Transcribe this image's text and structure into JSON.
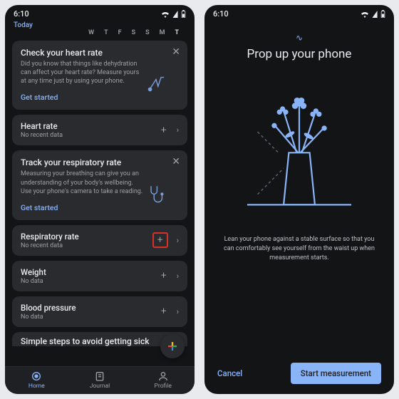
{
  "status": {
    "time": "6:10"
  },
  "left": {
    "today_label": "Today",
    "weekdays": [
      "W",
      "T",
      "F",
      "S",
      "S",
      "M",
      "T"
    ],
    "promo_heart": {
      "title": "Check your heart rate",
      "desc": "Did you know that things like dehydration can affect your heart rate? Measure yours at any time just by using your phone.",
      "cta": "Get started"
    },
    "row_heart": {
      "title": "Heart rate",
      "sub": "No recent data"
    },
    "promo_resp": {
      "title": "Track your respiratory rate",
      "desc": "Measuring your breathing can give you an understanding of your body's wellbeing. Use your phone's camera to take a reading.",
      "cta": "Get started"
    },
    "row_resp": {
      "title": "Respiratory rate",
      "sub": "No recent data"
    },
    "row_weight": {
      "title": "Weight",
      "sub": "No data"
    },
    "row_bp": {
      "title": "Blood pressure",
      "sub": "No data"
    },
    "section_sick": "Simple steps to avoid getting sick",
    "nav": {
      "home": "Home",
      "journal": "Journal",
      "profile": "Profile"
    }
  },
  "right": {
    "title": "Prop up your phone",
    "desc": "Lean your phone against a stable surface so that you can comfortably see yourself from the waist up when measurement starts.",
    "cancel": "Cancel",
    "start": "Start measurement"
  }
}
